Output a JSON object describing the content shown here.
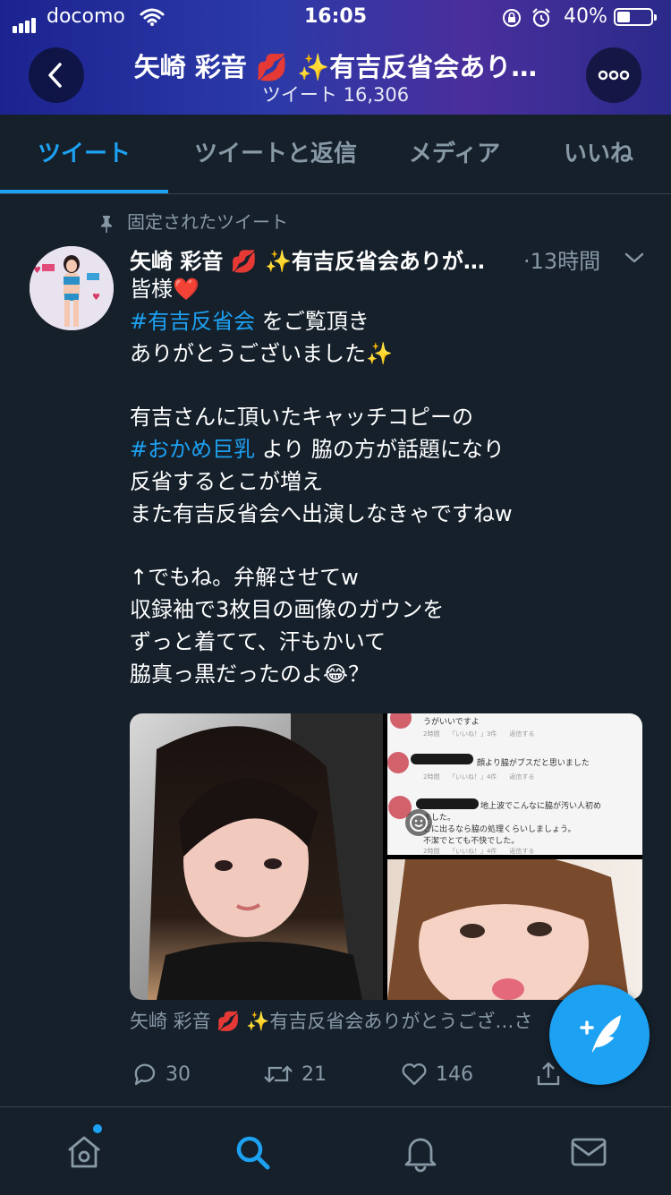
{
  "status_bar": {
    "carrier": "docomo",
    "time": "16:05",
    "battery": "40%",
    "battery_level": 0.4
  },
  "header": {
    "title": "矢崎 彩音 💋 ✨有吉反省会あり…",
    "subtitle": "ツイート 16,306",
    "back_icon": "chevron-left-icon",
    "more_icon": "more-icon"
  },
  "tabs": [
    {
      "label": "ツイート",
      "active": true
    },
    {
      "label": "ツイートと返信",
      "active": false
    },
    {
      "label": "メディア",
      "active": false
    },
    {
      "label": "いいね",
      "active": false
    }
  ],
  "tweet": {
    "pinned_label": "固定されたツイート",
    "author": "矢崎 彩音 💋 ✨有吉反省会ありが…",
    "time": "·13時間",
    "lines": {
      "l1": "皆様❤️",
      "l2_tag": "#有吉反省会",
      "l2_rest": " をご覧頂き",
      "l3": "ありがとうございました✨",
      "l4": "",
      "l5": "有吉さんに頂いたキャッチコピーの",
      "l6_tag": "#おかめ巨乳",
      "l6_rest": " より 脇の方が話題になり",
      "l7": "反省するとこが増え",
      "l8": "また有吉反省会へ出演しなきゃですねw",
      "l9": "",
      "l10": "↑でもね。弁解させてw",
      "l11": "収録袖で3枚目の画像のガウンを",
      "l12": "ずっと着てて、汗もかいて",
      "l13": "脇真っ黒だったのよ😂？"
    },
    "screenshot_text": {
      "c1": "うがいいですよ",
      "c1_meta": "2時間　　「いいね！」3件　　返信する",
      "c2": "顔より脇がブスだと思いました",
      "c2_meta": "2時間　　「いいね！」4件　　返信する",
      "c3a": "地上波でこんなに脇が汚い人初め",
      "c3b": "ました。",
      "c3c": "ビに出るなら脇の処理くらいしましょう。",
      "c3d": "不潔でとても不快でした。",
      "c3_meta": "2時間　　「いいね！」4件　　返信する"
    },
    "quote_line": "矢崎 彩音 💋 ✨有吉反省会ありがとうござ…さ",
    "replies": "30",
    "retweets": "21",
    "likes": "146"
  },
  "bottom_nav": [
    {
      "icon": "home-icon"
    },
    {
      "icon": "search-icon"
    },
    {
      "icon": "bell-icon"
    },
    {
      "icon": "mail-icon"
    }
  ],
  "colors": {
    "background": "#15202b",
    "accent": "#1da1f2",
    "muted": "#8899a6"
  }
}
